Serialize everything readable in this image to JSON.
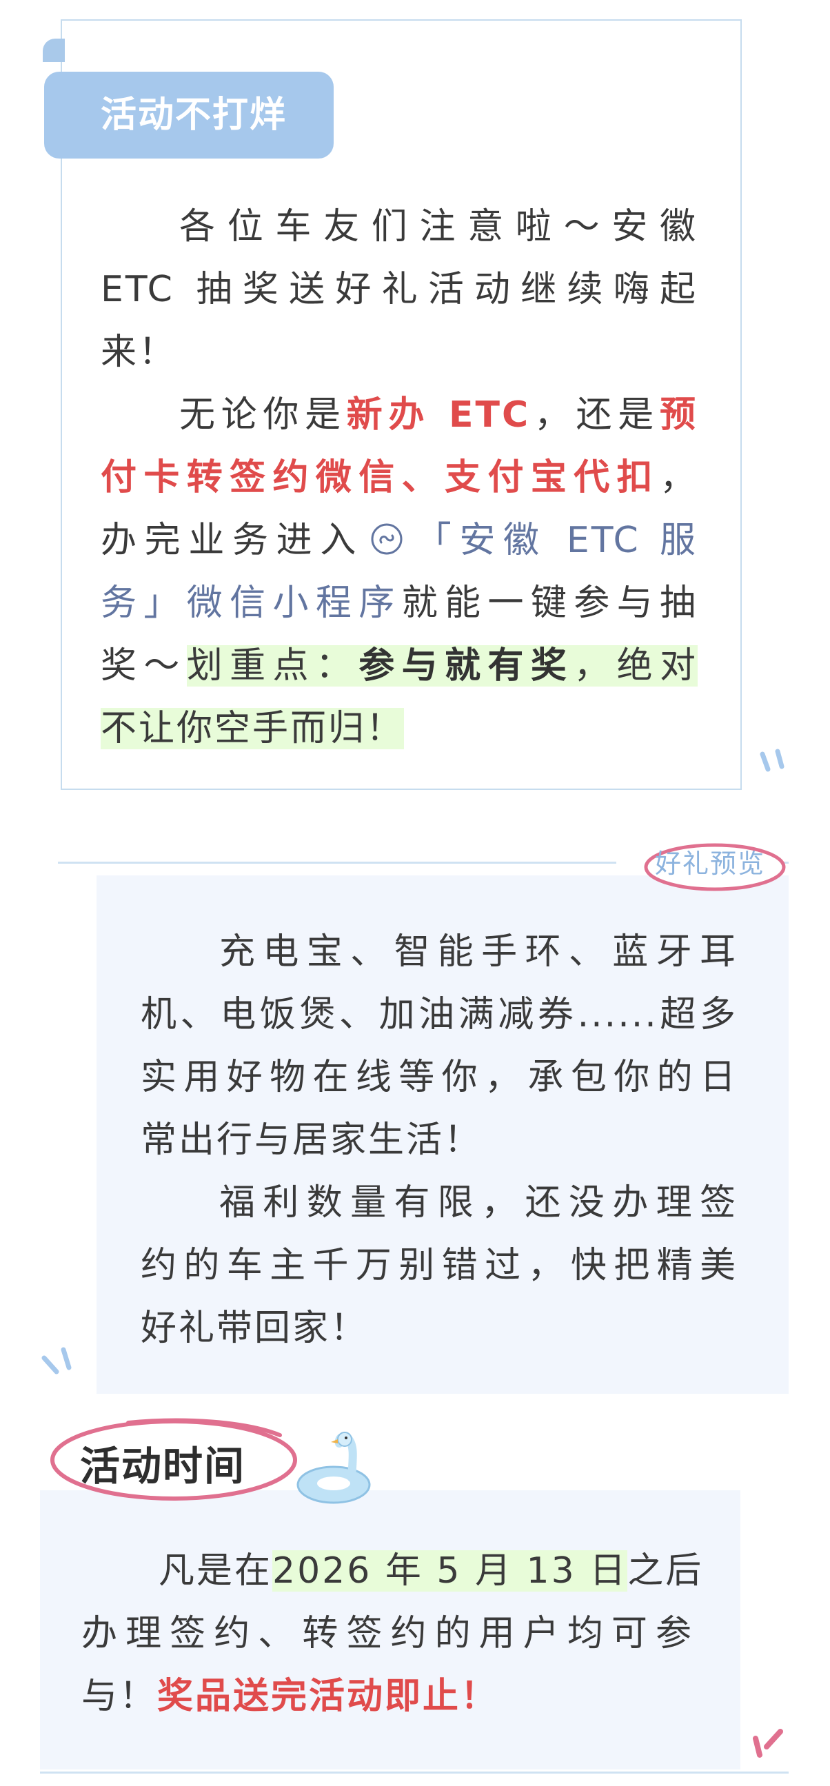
{
  "section1": {
    "tag": "活动不打烊",
    "lines": [
      [
        "各位车友们注意啦～安徽"
      ],
      [
        "ETC 抽奖送好礼活动继续嗨起"
      ],
      [
        "来！"
      ],
      [
        "无论你是",
        "新办 ETC",
        "，还是",
        "预"
      ],
      [
        "付卡转签约微信、支付宝代扣",
        "，"
      ],
      [
        "办完业务进入",
        "「安徽 ETC 服"
      ],
      [
        "务」微信小程序",
        "就能一键参与抽"
      ],
      [
        "奖～",
        "划重点：",
        "参与就有奖",
        "，绝对"
      ],
      [
        "不让你空手而归！"
      ]
    ]
  },
  "section2": {
    "badge": "好礼预览",
    "lines": [
      "充电宝、智能手环、蓝牙耳",
      "机、电饭煲、加油满减券......超多",
      "实用好物在线等你，承包你的日",
      "常出行与居家生活！",
      "福利数量有限，还没办理签",
      "约的车主千万别错过，快把精美",
      "好礼带回家！"
    ]
  },
  "section3": {
    "title": "活动时间",
    "lines": [
      [
        "凡是在",
        "2026 年 5 月 13 日",
        "之后"
      ],
      [
        "办理签约、转签约的用户均可参"
      ],
      [
        "与！",
        "奖品送完活动即止！"
      ]
    ]
  },
  "colors": {
    "accent_red": "#e04b4b",
    "link_blue": "#6275a0",
    "highlight_green": "#e8fcd9",
    "tab_blue": "#a6c8ec",
    "panel_bg": "#f2f6fd",
    "pink": "#e0708f"
  }
}
